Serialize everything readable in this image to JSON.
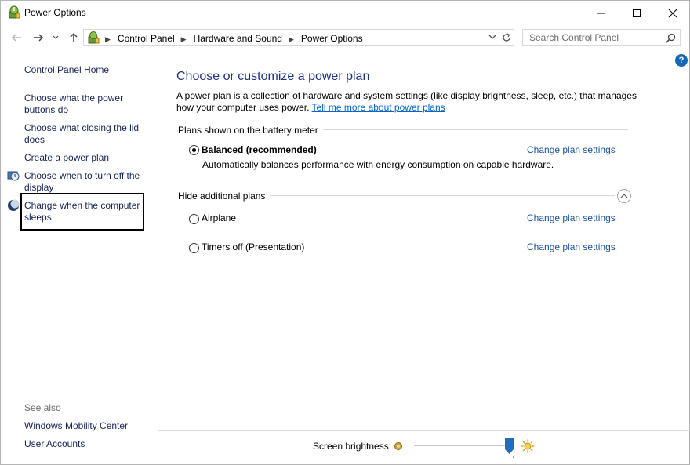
{
  "window": {
    "title": "Power Options",
    "controls": {
      "minimize": "minimize-icon",
      "maximize": "maximize-icon",
      "close": "close-icon"
    }
  },
  "address": {
    "breadcrumbs": [
      "Control Panel",
      "Hardware and Sound",
      "Power Options"
    ],
    "search_placeholder": "Search Control Panel"
  },
  "sidebar": {
    "home": "Control Panel Home",
    "links": [
      {
        "label": "Choose what the power buttons do"
      },
      {
        "label": "Choose what closing the lid does"
      },
      {
        "label": "Create a power plan"
      },
      {
        "label": "Choose when to turn off the display",
        "icon": "display-clock-icon"
      },
      {
        "label": "Change when the computer sleeps",
        "icon": "sleep-moon-icon"
      }
    ],
    "see_also_label": "See also",
    "see_also": [
      "Windows Mobility Center",
      "User Accounts"
    ]
  },
  "main": {
    "title": "Choose or customize a power plan",
    "description": "A power plan is a collection of hardware and system settings (like display brightness, sleep, etc.) that manages how your computer uses power.",
    "learn_more": "Tell me more about power plans",
    "battery_meter_label": "Plans shown on the battery meter",
    "hide_additional_label": "Hide additional plans",
    "change_settings_label": "Change plan settings",
    "plans": [
      {
        "name": "Balanced (recommended)",
        "selected": true,
        "description": "Automatically balances performance with energy consumption on capable hardware."
      },
      {
        "name": "Airplane",
        "selected": false
      },
      {
        "name": "Timers off (Presentation)",
        "selected": false
      }
    ]
  },
  "footer": {
    "brightness_label": "Screen brightness:",
    "brightness_level": 0.95
  },
  "colors": {
    "link": "#1a53a6",
    "title": "#1e3287",
    "help": "#1668b5",
    "slider_thumb": "#1f6cc1"
  }
}
